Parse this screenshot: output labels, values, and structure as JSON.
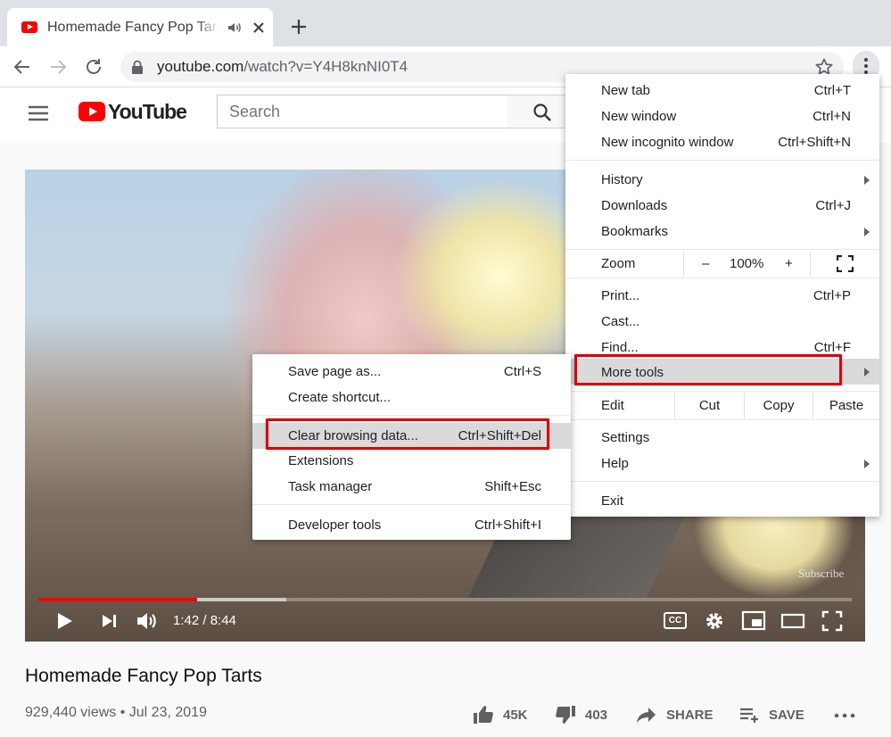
{
  "browser": {
    "tab_title": "Homemade Fancy Pop Tarts",
    "url_host": "youtube.com",
    "url_path": "/watch?v=Y4H8knNI0T4"
  },
  "youtube": {
    "logo_text": "YouTube",
    "search_placeholder": "Search"
  },
  "player": {
    "time_display": "1:42 / 8:44",
    "progress_fraction": 0.195,
    "buffered_fraction": 0.305,
    "watermark": "Subscribe",
    "cc_label": "CC"
  },
  "video": {
    "title": "Homemade Fancy Pop Tarts",
    "meta": "929,440 views • Jul 23, 2019",
    "likes": "45K",
    "dislikes": "403",
    "share": "SHARE",
    "save": "SAVE"
  },
  "menu": {
    "new_tab": {
      "label": "New tab",
      "shortcut": "Ctrl+T"
    },
    "new_window": {
      "label": "New window",
      "shortcut": "Ctrl+N"
    },
    "new_incognito": {
      "label": "New incognito window",
      "shortcut": "Ctrl+Shift+N"
    },
    "history": {
      "label": "History"
    },
    "downloads": {
      "label": "Downloads",
      "shortcut": "Ctrl+J"
    },
    "bookmarks": {
      "label": "Bookmarks"
    },
    "zoom": {
      "label": "Zoom",
      "minus": "–",
      "value": "100%",
      "plus": "+"
    },
    "print": {
      "label": "Print...",
      "shortcut": "Ctrl+P"
    },
    "cast": {
      "label": "Cast..."
    },
    "find": {
      "label": "Find...",
      "shortcut": "Ctrl+F"
    },
    "more_tools": {
      "label": "More tools"
    },
    "edit": {
      "label": "Edit",
      "cut": "Cut",
      "copy": "Copy",
      "paste": "Paste"
    },
    "settings": {
      "label": "Settings"
    },
    "help": {
      "label": "Help"
    },
    "exit": {
      "label": "Exit"
    }
  },
  "submenu": {
    "save_page": {
      "label": "Save page as...",
      "shortcut": "Ctrl+S"
    },
    "create_shortcut": {
      "label": "Create shortcut..."
    },
    "clear_browsing": {
      "label": "Clear browsing data...",
      "shortcut": "Ctrl+Shift+Del"
    },
    "extensions": {
      "label": "Extensions"
    },
    "task_manager": {
      "label": "Task manager",
      "shortcut": "Shift+Esc"
    },
    "developer_tools": {
      "label": "Developer tools",
      "shortcut": "Ctrl+Shift+I"
    }
  },
  "colors": {
    "highlight_annotation": "#d9000b",
    "youtube_red": "#ff0000",
    "menu_hover": "#dadada"
  }
}
